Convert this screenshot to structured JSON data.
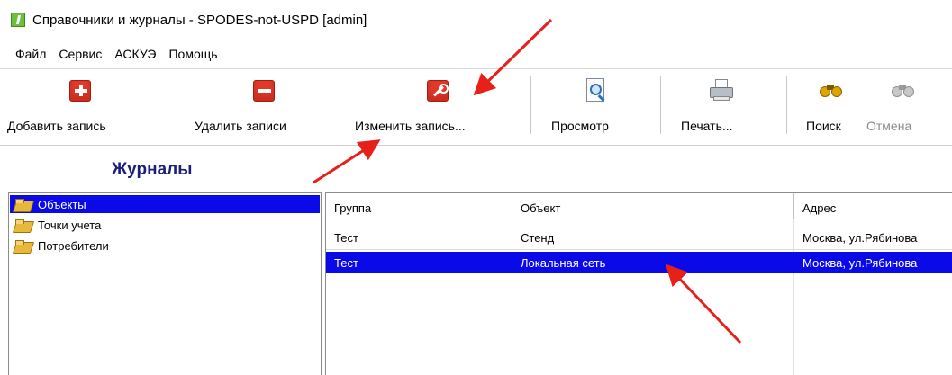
{
  "window": {
    "title": "Справочники и журналы - SPODES-not-USPD  [admin]",
    "app_icon": "app-icon"
  },
  "menu": {
    "items": [
      "Файл",
      "Сервис",
      "АСКУЭ",
      "Помощь"
    ]
  },
  "toolbar": {
    "add_label": "Добавить запись",
    "delete_label": "Удалить записи",
    "edit_label": "Изменить запись...",
    "preview_label": "Просмотр",
    "print_label": "Печать...",
    "search_label": "Поиск",
    "cancel_label": "Отмена"
  },
  "section": {
    "title": "Журналы"
  },
  "tree": {
    "items": [
      "Объекты",
      "Точки учета",
      "Потребители"
    ],
    "selected_index": 0
  },
  "table": {
    "columns": [
      "Группа",
      "Объект",
      "Адрес"
    ],
    "rows": [
      {
        "group": "Тест",
        "object": "Стенд",
        "address": "Москва, ул.Рябинова"
      },
      {
        "group": "Тест",
        "object": "Локальная сеть",
        "address": "Москва, ул.Рябинова"
      }
    ],
    "selected_index": 1
  },
  "colors": {
    "selection": "#0a0ae8",
    "section_title": "#1a1f7a",
    "annotation_arrow": "#e8201a",
    "toolbar_action_red": "#e23a2a"
  }
}
